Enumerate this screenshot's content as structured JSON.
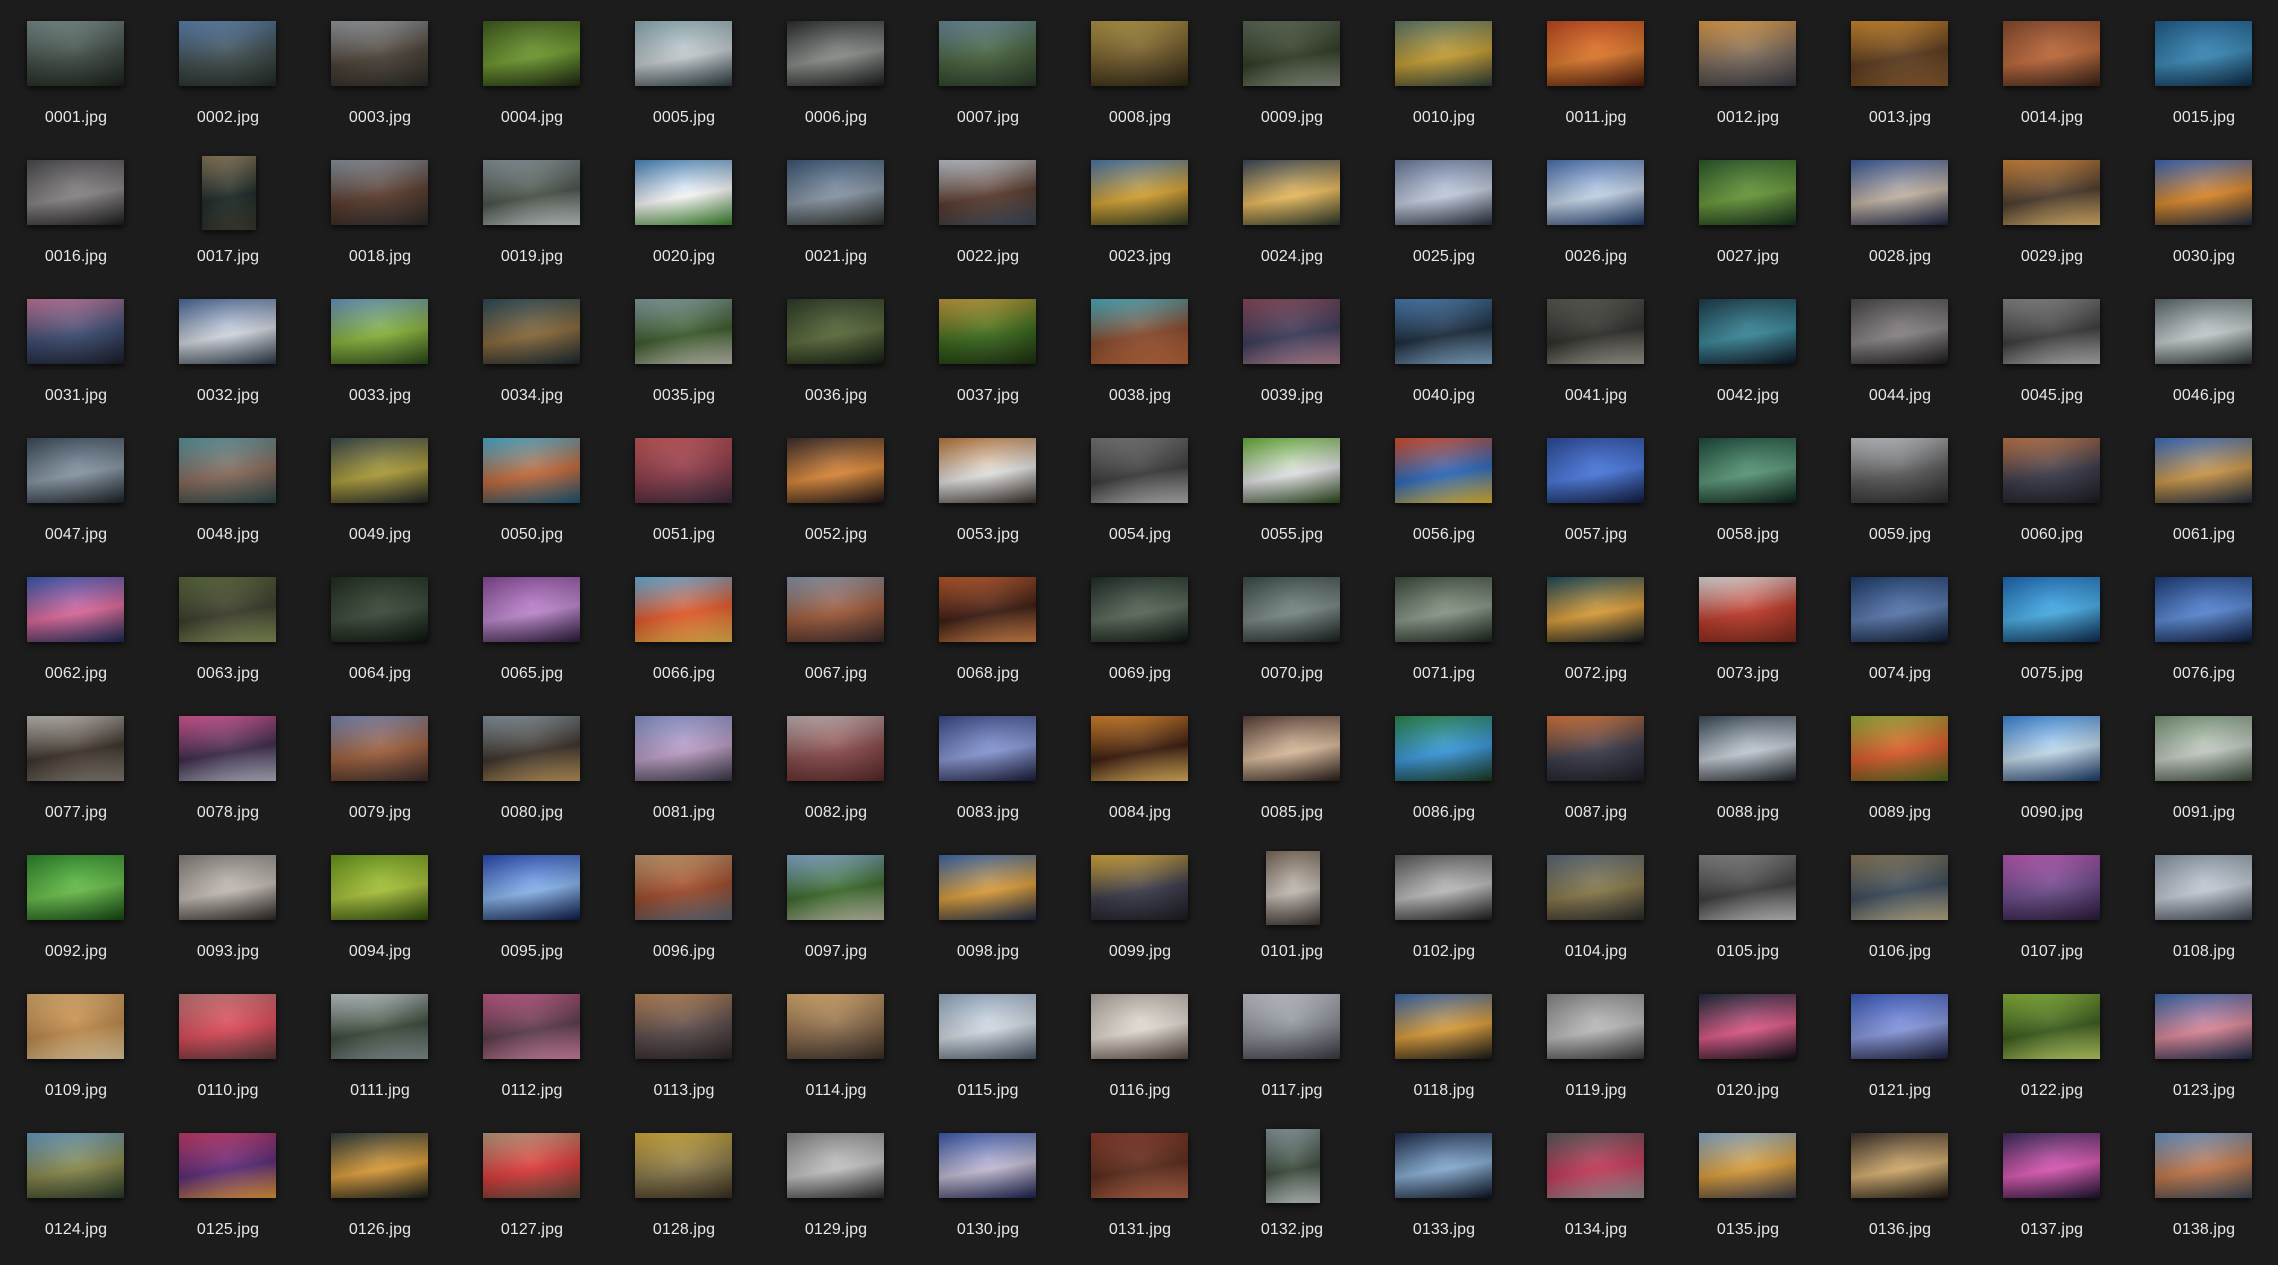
{
  "files": [
    {
      "name": "0001.jpg",
      "colors": [
        "#7d8f92",
        "#3c4a40",
        "#1d221c"
      ]
    },
    {
      "name": "0002.jpg",
      "colors": [
        "#5f86b6",
        "#3d4c4e",
        "#232c24"
      ]
    },
    {
      "name": "0003.jpg",
      "colors": [
        "#9aa0a6",
        "#4a4034",
        "#2b2a26"
      ]
    },
    {
      "name": "0004.jpg",
      "colors": [
        "#3e5a1c",
        "#6f9a2e",
        "#1c2a10"
      ]
    },
    {
      "name": "0005.jpg",
      "colors": [
        "#8fb0b8",
        "#c8cfd2",
        "#2c3e44"
      ]
    },
    {
      "name": "0006.jpg",
      "colors": [
        "#2a2d2c",
        "#8c8f8c",
        "#1a1c1b"
      ]
    },
    {
      "name": "0007.jpg",
      "colors": [
        "#6b8ea0",
        "#45613a",
        "#2b3a2a"
      ]
    },
    {
      "name": "0008.jpg",
      "colors": [
        "#b79a45",
        "#6d5728",
        "#2c2412"
      ]
    },
    {
      "name": "0009.jpg",
      "colors": [
        "#5e6a58",
        "#2f3a22",
        "#8c9486"
      ]
    },
    {
      "name": "0010.jpg",
      "colors": [
        "#5d7a6c",
        "#c8a032",
        "#2e403a"
      ]
    },
    {
      "name": "0011.jpg",
      "colors": [
        "#c4481d",
        "#e07a2c",
        "#4a1a0c"
      ]
    },
    {
      "name": "0012.jpg",
      "colors": [
        "#e8a24a",
        "#7a6a5a",
        "#3a3a44"
      ]
    },
    {
      "name": "0013.jpg",
      "colors": [
        "#d68c2a",
        "#5a3a1c",
        "#8a5a2c"
      ]
    },
    {
      "name": "0014.jpg",
      "colors": [
        "#8a4a2c",
        "#c06a3a",
        "#3a2218"
      ]
    },
    {
      "name": "0015.jpg",
      "colors": [
        "#1e5c8c",
        "#3a8ab8",
        "#0c2a46"
      ]
    },
    {
      "name": "0016.jpg",
      "colors": [
        "#4a4a4e",
        "#8c8688",
        "#1e1e20"
      ]
    },
    {
      "name": "0017.jpg",
      "colors": [
        "#8c7a5a",
        "#1a2826",
        "#3c3a2c"
      ],
      "portrait": true
    },
    {
      "name": "0018.jpg",
      "colors": [
        "#8c9aa6",
        "#5a3a2c",
        "#2c2a2a"
      ]
    },
    {
      "name": "0019.jpg",
      "colors": [
        "#8c9aa0",
        "#4a5248",
        "#cfd6d8"
      ]
    },
    {
      "name": "0020.jpg",
      "colors": [
        "#4a8ac4",
        "#ffffff",
        "#3c8a2c"
      ]
    },
    {
      "name": "0021.jpg",
      "colors": [
        "#3a5878",
        "#8a98a8",
        "#2c3028"
      ]
    },
    {
      "name": "0022.jpg",
      "colors": [
        "#c8d2dc",
        "#5a3a2c",
        "#3c4a5a"
      ]
    },
    {
      "name": "0023.jpg",
      "colors": [
        "#4a7ab0",
        "#d8a432",
        "#2c3a22"
      ]
    },
    {
      "name": "0024.jpg",
      "colors": [
        "#3a4a5a",
        "#f0c060",
        "#2c3a2a"
      ]
    },
    {
      "name": "0025.jpg",
      "colors": [
        "#6a7ca0",
        "#c8d2e4",
        "#2c3040"
      ]
    },
    {
      "name": "0026.jpg",
      "colors": [
        "#4a72b4",
        "#c8d8ec",
        "#1e3a6a"
      ]
    },
    {
      "name": "0027.jpg",
      "colors": [
        "#2a5a2a",
        "#6a9a3a",
        "#14301a"
      ]
    },
    {
      "name": "0028.jpg",
      "colors": [
        "#3a5a9c",
        "#c8b8a8",
        "#1a2444"
      ]
    },
    {
      "name": "0029.jpg",
      "colors": [
        "#d88a3a",
        "#4a3a2c",
        "#f0c070"
      ]
    },
    {
      "name": "0030.jpg",
      "colors": [
        "#3a6ac0",
        "#e08a2a",
        "#1c2a40"
      ]
    },
    {
      "name": "0031.jpg",
      "colors": [
        "#c87aa0",
        "#3a4a70",
        "#1a1e2c"
      ]
    },
    {
      "name": "0032.jpg",
      "colors": [
        "#4a6a9c",
        "#d8dce4",
        "#2c3a4a"
      ]
    },
    {
      "name": "0033.jpg",
      "colors": [
        "#6a9ac8",
        "#8ab43a",
        "#2c4a1c"
      ]
    },
    {
      "name": "0034.jpg",
      "colors": [
        "#2a4a5a",
        "#8a6a3a",
        "#1a2a30"
      ]
    },
    {
      "name": "0035.jpg",
      "colors": [
        "#8aa4a8",
        "#3a5a2a",
        "#c8c8b8"
      ]
    },
    {
      "name": "0036.jpg",
      "colors": [
        "#2a3a26",
        "#5a6a3a",
        "#141c12"
      ]
    },
    {
      "name": "0037.jpg",
      "colors": [
        "#c8a03a",
        "#3a6a1a",
        "#1c3010"
      ]
    },
    {
      "name": "0038.jpg",
      "colors": [
        "#4ab4c8",
        "#8a4a2c",
        "#c46a3a"
      ]
    },
    {
      "name": "0039.jpg",
      "colors": [
        "#8a4a5a",
        "#3a3a5a",
        "#c08a9a"
      ]
    },
    {
      "name": "0040.jpg",
      "colors": [
        "#4a80b8",
        "#1a2a3a",
        "#8ab4d8"
      ]
    },
    {
      "name": "0041.jpg",
      "colors": [
        "#5a5a54",
        "#2c2c28",
        "#a8a498"
      ]
    },
    {
      "name": "0042.jpg",
      "colors": [
        "#1a3a4a",
        "#3a8a9c",
        "#0c1420"
      ]
    },
    {
      "name": "0044.jpg",
      "colors": [
        "#4a4648",
        "#8a8486",
        "#1c1a1c"
      ]
    },
    {
      "name": "0045.jpg",
      "colors": [
        "#8a8a8a",
        "#3a3a3a",
        "#c0c0c0"
      ]
    },
    {
      "name": "0046.jpg",
      "colors": [
        "#5a6a6c",
        "#c8d0d2",
        "#2a3234"
      ]
    },
    {
      "name": "0047.jpg",
      "colors": [
        "#3a4a5a",
        "#8a9aa8",
        "#1c2228"
      ]
    },
    {
      "name": "0048.jpg",
      "colors": [
        "#5a9aa4",
        "#8a6a5a",
        "#2a4a4c"
      ]
    },
    {
      "name": "0049.jpg",
      "colors": [
        "#3a4a4c",
        "#b0a03a",
        "#1c2426"
      ]
    },
    {
      "name": "0050.jpg",
      "colors": [
        "#4ab4d8",
        "#c86a3a",
        "#1a5a7a"
      ]
    },
    {
      "name": "0051.jpg",
      "colors": [
        "#c85a5a",
        "#8a3a4a",
        "#3a2a3a"
      ]
    },
    {
      "name": "0052.jpg",
      "colors": [
        "#3a2c2a",
        "#e08a3a",
        "#1a1414"
      ]
    },
    {
      "name": "0053.jpg",
      "colors": [
        "#c07a3a",
        "#e8e8e8",
        "#3a3028"
      ]
    },
    {
      "name": "0054.jpg",
      "colors": [
        "#7a7a7a",
        "#3a3a3a",
        "#c0c0c0"
      ]
    },
    {
      "name": "0055.jpg",
      "colors": [
        "#6ab43a",
        "#e8e8ec",
        "#2c4a1c"
      ]
    },
    {
      "name": "0056.jpg",
      "colors": [
        "#e0502a",
        "#2a6ac0",
        "#f0c030"
      ]
    },
    {
      "name": "0057.jpg",
      "colors": [
        "#2a4a9c",
        "#4a7ae0",
        "#101c40"
      ]
    },
    {
      "name": "0058.jpg",
      "colors": [
        "#1a4a3a",
        "#5a9a7a",
        "#0c2018"
      ]
    },
    {
      "name": "0059.jpg",
      "colors": [
        "#c8ccd0",
        "#5a5a5a",
        "#2a2a2a"
      ]
    },
    {
      "name": "0060.jpg",
      "colors": [
        "#c87a4a",
        "#3a3a4a",
        "#1c1c24"
      ]
    },
    {
      "name": "0061.jpg",
      "colors": [
        "#3a70c8",
        "#d09a4a",
        "#1c2a40"
      ]
    },
    {
      "name": "0062.jpg",
      "colors": [
        "#3a5ab8",
        "#e06a9a",
        "#1a2a5a"
      ]
    },
    {
      "name": "0063.jpg",
      "colors": [
        "#5a6a3a",
        "#3a3a2a",
        "#8a9a5a"
      ]
    },
    {
      "name": "0064.jpg",
      "colors": [
        "#1c2c1c",
        "#3a4a3a",
        "#0c140c"
      ]
    },
    {
      "name": "0065.jpg",
      "colors": [
        "#8a4a9c",
        "#c08ad0",
        "#2a1a3a"
      ]
    },
    {
      "name": "0066.jpg",
      "colors": [
        "#6ab8e8",
        "#e85a2a",
        "#f0c050"
      ]
    },
    {
      "name": "0067.jpg",
      "colors": [
        "#8a9ab0",
        "#a05a3a",
        "#3a2a2a"
      ]
    },
    {
      "name": "0068.jpg",
      "colors": [
        "#c05a2a",
        "#3a1a10",
        "#e08a4a"
      ]
    },
    {
      "name": "0069.jpg",
      "colors": [
        "#1c2a24",
        "#5a6a5a",
        "#0c1410"
      ]
    },
    {
      "name": "0070.jpg",
      "colors": [
        "#3a4a4a",
        "#7a8a88",
        "#1a2220"
      ]
    },
    {
      "name": "0071.jpg",
      "colors": [
        "#3a4a3a",
        "#8a9a8a",
        "#1c241c"
      ]
    },
    {
      "name": "0072.jpg",
      "colors": [
        "#1a4a5a",
        "#e0a03a",
        "#0c1c24"
      ]
    },
    {
      "name": "0073.jpg",
      "colors": [
        "#e8e8e8",
        "#c03a2a",
        "#7a2a1a"
      ]
    },
    {
      "name": "0074.jpg",
      "colors": [
        "#1a3a6a",
        "#5a7ab0",
        "#0c1a30"
      ]
    },
    {
      "name": "0075.jpg",
      "colors": [
        "#1a6ab8",
        "#4ab0e8",
        "#0c2c50"
      ]
    },
    {
      "name": "0076.jpg",
      "colors": [
        "#1a3a7a",
        "#5a8ad8",
        "#0c1a3a"
      ]
    },
    {
      "name": "0077.jpg",
      "colors": [
        "#c8c4bc",
        "#3a3028",
        "#8a8278"
      ]
    },
    {
      "name": "0078.jpg",
      "colors": [
        "#e05a9a",
        "#3a2a4a",
        "#c0c0d0"
      ]
    },
    {
      "name": "0079.jpg",
      "colors": [
        "#7a8ab8",
        "#a0603a",
        "#3a2a2a"
      ]
    },
    {
      "name": "0080.jpg",
      "colors": [
        "#8a9aa4",
        "#3a3028",
        "#c8a060"
      ]
    },
    {
      "name": "0081.jpg",
      "colors": [
        "#8a9ad0",
        "#c0a0c8",
        "#3a3a4a"
      ]
    },
    {
      "name": "0082.jpg",
      "colors": [
        "#c8b8b8",
        "#8a4a4a",
        "#5a2a2a"
      ]
    },
    {
      "name": "0083.jpg",
      "colors": [
        "#3a4a8a",
        "#8a9ad8",
        "#1a1c3a"
      ]
    },
    {
      "name": "0084.jpg",
      "colors": [
        "#e08a2a",
        "#3a1a0c",
        "#f0c060"
      ]
    },
    {
      "name": "0085.jpg",
      "colors": [
        "#5a4038",
        "#e0c0a0",
        "#2a1e1a"
      ]
    },
    {
      "name": "0086.jpg",
      "colors": [
        "#2a8a4a",
        "#3a9ae0",
        "#1a3a20"
      ]
    },
    {
      "name": "0087.jpg",
      "colors": [
        "#e07a3a",
        "#3a3a4a",
        "#1c1c24"
      ]
    },
    {
      "name": "0088.jpg",
      "colors": [
        "#3a4a5a",
        "#c8d0d8",
        "#1a2028"
      ]
    },
    {
      "name": "0089.jpg",
      "colors": [
        "#9ab43a",
        "#e05a2a",
        "#4a6a1c"
      ]
    },
    {
      "name": "0090.jpg",
      "colors": [
        "#3a8ae0",
        "#c8e0f0",
        "#1a3a6a"
      ]
    },
    {
      "name": "0091.jpg",
      "colors": [
        "#7a9a7a",
        "#c8d0c8",
        "#3a4a3a"
      ]
    },
    {
      "name": "0092.jpg",
      "colors": [
        "#2a8a2a",
        "#6ac04a",
        "#144a14"
      ]
    },
    {
      "name": "0093.jpg",
      "colors": [
        "#8a8480",
        "#c8c0b8",
        "#2a2624"
      ]
    },
    {
      "name": "0094.jpg",
      "colors": [
        "#6a9a1a",
        "#aac43a",
        "#2c4a0c"
      ]
    },
    {
      "name": "0095.jpg",
      "colors": [
        "#2a4ab8",
        "#8ab8f0",
        "#0c1a4a"
      ]
    },
    {
      "name": "0096.jpg",
      "colors": [
        "#c8a070",
        "#a04a2a",
        "#5a6a7a"
      ]
    },
    {
      "name": "0097.jpg",
      "colors": [
        "#8ab0d8",
        "#3a6a2a",
        "#c8c8b0"
      ]
    },
    {
      "name": "0098.jpg",
      "colors": [
        "#3a6ab0",
        "#e0a03a",
        "#1a2a4a"
      ]
    },
    {
      "name": "0099.jpg",
      "colors": [
        "#e0b03a",
        "#3a3a4a",
        "#1c1c24"
      ]
    },
    {
      "name": "0101.jpg",
      "colors": [
        "#7a6a5a",
        "#c8c0b8",
        "#3a302a"
      ],
      "portrait": true
    },
    {
      "name": "0102.jpg",
      "colors": [
        "#5a5a5a",
        "#c0c0c0",
        "#1e1e1e"
      ]
    },
    {
      "name": "0104.jpg",
      "colors": [
        "#5a6a7a",
        "#8a7a4a",
        "#2a2a2a"
      ]
    },
    {
      "name": "0105.jpg",
      "colors": [
        "#8a8a8a",
        "#3a3a3a",
        "#d0d0d0"
      ]
    },
    {
      "name": "0106.jpg",
      "colors": [
        "#8a7a5a",
        "#3a4a5a",
        "#c8b890"
      ]
    },
    {
      "name": "0107.jpg",
      "colors": [
        "#c05ab8",
        "#6a4a8a",
        "#2a1a3a"
      ]
    },
    {
      "name": "0108.jpg",
      "colors": [
        "#8a9aa8",
        "#c8d0d8",
        "#3a4450"
      ]
    },
    {
      "name": "0109.jpg",
      "colors": [
        "#e0b070",
        "#c08a4a",
        "#f0d8a8"
      ]
    },
    {
      "name": "0110.jpg",
      "colors": [
        "#c87a7a",
        "#e04a5a",
        "#5a3a3a"
      ]
    },
    {
      "name": "0111.jpg",
      "colors": [
        "#c8d0d4",
        "#3a4a3a",
        "#8a9a9c"
      ]
    },
    {
      "name": "0112.jpg",
      "colors": [
        "#c85a8a",
        "#5a3a4a",
        "#e08ab0"
      ]
    },
    {
      "name": "0113.jpg",
      "colors": [
        "#c08a5a",
        "#5a4a4a",
        "#2a2424"
      ]
    },
    {
      "name": "0114.jpg",
      "colors": [
        "#e0b070",
        "#8a6a4a",
        "#3a3028"
      ]
    },
    {
      "name": "0115.jpg",
      "colors": [
        "#9ab0c8",
        "#d8e0e8",
        "#4a5a6a"
      ]
    },
    {
      "name": "0116.jpg",
      "colors": [
        "#b8b0a8",
        "#e8e0d8",
        "#5a4a40"
      ]
    },
    {
      "name": "0117.jpg",
      "colors": [
        "#c8ccd4",
        "#8a8e96",
        "#3a3c44"
      ]
    },
    {
      "name": "0118.jpg",
      "colors": [
        "#3a6ab0",
        "#e0a03a",
        "#1a1a1a"
      ]
    },
    {
      "name": "0119.jpg",
      "colors": [
        "#8a8a8a",
        "#c0c0c0",
        "#3a3a3a"
      ]
    },
    {
      "name": "0120.jpg",
      "colors": [
        "#1a2a3a",
        "#e05a8a",
        "#0c1018"
      ]
    },
    {
      "name": "0121.jpg",
      "colors": [
        "#3a5ac0",
        "#8a9ae0",
        "#1a1e3a"
      ]
    },
    {
      "name": "0122.jpg",
      "colors": [
        "#8ab83a",
        "#3a5a1a",
        "#c8e06a"
      ]
    },
    {
      "name": "0123.jpg",
      "colors": [
        "#3a6ab0",
        "#e08a9a",
        "#1a2a4a"
      ]
    },
    {
      "name": "0124.jpg",
      "colors": [
        "#6aa0c8",
        "#8a8a4a",
        "#2a3a2a"
      ]
    },
    {
      "name": "0125.jpg",
      "colors": [
        "#c83a6a",
        "#5a2a7a",
        "#f0a03a"
      ]
    },
    {
      "name": "0126.jpg",
      "colors": [
        "#2a3a3a",
        "#e0a03a",
        "#141c1c"
      ]
    },
    {
      "name": "0127.jpg",
      "colors": [
        "#c0a080",
        "#e03a3a",
        "#5a4a3a"
      ]
    },
    {
      "name": "0128.jpg",
      "colors": [
        "#d8b03a",
        "#8a7a4a",
        "#3a3020"
      ]
    },
    {
      "name": "0129.jpg",
      "colors": [
        "#8a8a8a",
        "#c8c8c8",
        "#2a2a2a"
      ]
    },
    {
      "name": "0130.jpg",
      "colors": [
        "#3a5ab0",
        "#c8c0d8",
        "#1a2050"
      ]
    },
    {
      "name": "0131.jpg",
      "colors": [
        "#8a3a2a",
        "#5a2a1a",
        "#c06a4a"
      ]
    },
    {
      "name": "0132.jpg",
      "colors": [
        "#8a9aa0",
        "#3a4a3a",
        "#c8d0d0"
      ],
      "portrait": true
    },
    {
      "name": "0133.jpg",
      "colors": [
        "#1a2a4a",
        "#8ab0d8",
        "#0c1424"
      ]
    },
    {
      "name": "0134.jpg",
      "colors": [
        "#5a5a5a",
        "#c83a5a",
        "#9a9a9a"
      ]
    },
    {
      "name": "0135.jpg",
      "colors": [
        "#8ab0d0",
        "#e0a03a",
        "#3a3a4a"
      ]
    },
    {
      "name": "0136.jpg",
      "colors": [
        "#3a3028",
        "#d8b070",
        "#1a1612"
      ]
    },
    {
      "name": "0137.jpg",
      "colors": [
        "#3a2a5a",
        "#e05ab8",
        "#1a1430"
      ]
    },
    {
      "name": "0138.jpg",
      "colors": [
        "#6a9ad0",
        "#c87a4a",
        "#3a4a5a"
      ]
    }
  ]
}
